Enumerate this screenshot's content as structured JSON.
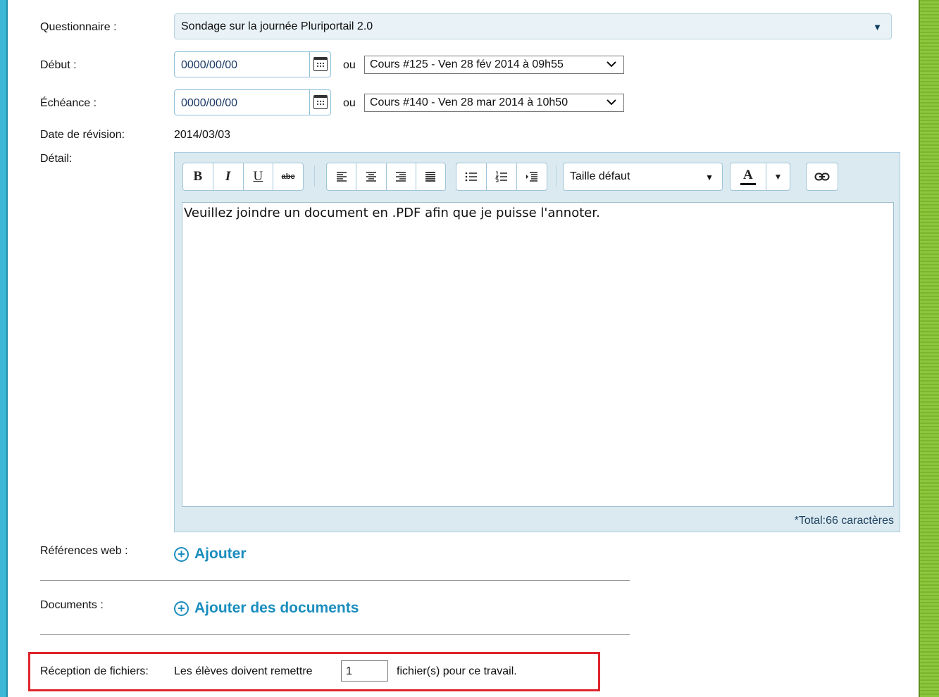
{
  "form": {
    "questionnaire": {
      "label": "Questionnaire :",
      "value": "Sondage sur la journée Pluriportail 2.0",
      "arrow": "▼"
    },
    "debut": {
      "label": "Début :",
      "date": "0000/00/00",
      "ou": "ou",
      "cours": "Cours #125 - Ven 28 fév 2014 à 09h55"
    },
    "echeance": {
      "label": "Échéance :",
      "date": "0000/00/00",
      "ou": "ou",
      "cours": "Cours #140 - Ven 28 mar 2014 à 10h50"
    },
    "revision": {
      "label": "Date de révision:",
      "value": "2014/03/03"
    },
    "detail": {
      "label": "Détail:",
      "toolbar": {
        "bold": "B",
        "italic": "I",
        "underline": "U",
        "strike": "abc",
        "font_size": "Taille défaut",
        "font_size_arrow": "▼",
        "color_letter": "A",
        "color_arrow": "▼"
      },
      "content": "Veuillez joindre un document en .PDF afin que je puisse l'annoter.",
      "total": "*Total:66 caractères"
    },
    "web_refs": {
      "label": "Références web :",
      "add": "Ajouter"
    },
    "documents": {
      "label": "Documents :",
      "add": "Ajouter des documents"
    },
    "reception": {
      "label": "Réception de fichiers:",
      "text_before": "Les élèves doivent remettre",
      "count": "1",
      "text_after": "fichier(s) pour ce travail."
    }
  },
  "icons": [
    "calendar-icon",
    "align-left-icon",
    "align-center-icon",
    "align-right-icon",
    "justify-icon",
    "bullet-list-icon",
    "numbered-list-icon",
    "indent-icon",
    "link-icon",
    "plus-circle-icon",
    "chevron-down-icon"
  ],
  "colors": {
    "accent": "#1a8dbe",
    "left_strip": "#3cb8d6",
    "right_strip": "#8cc63e",
    "highlight": "#e0242b",
    "editor_bg": "#dbeaf1",
    "select_bg": "#e8f2f7"
  }
}
